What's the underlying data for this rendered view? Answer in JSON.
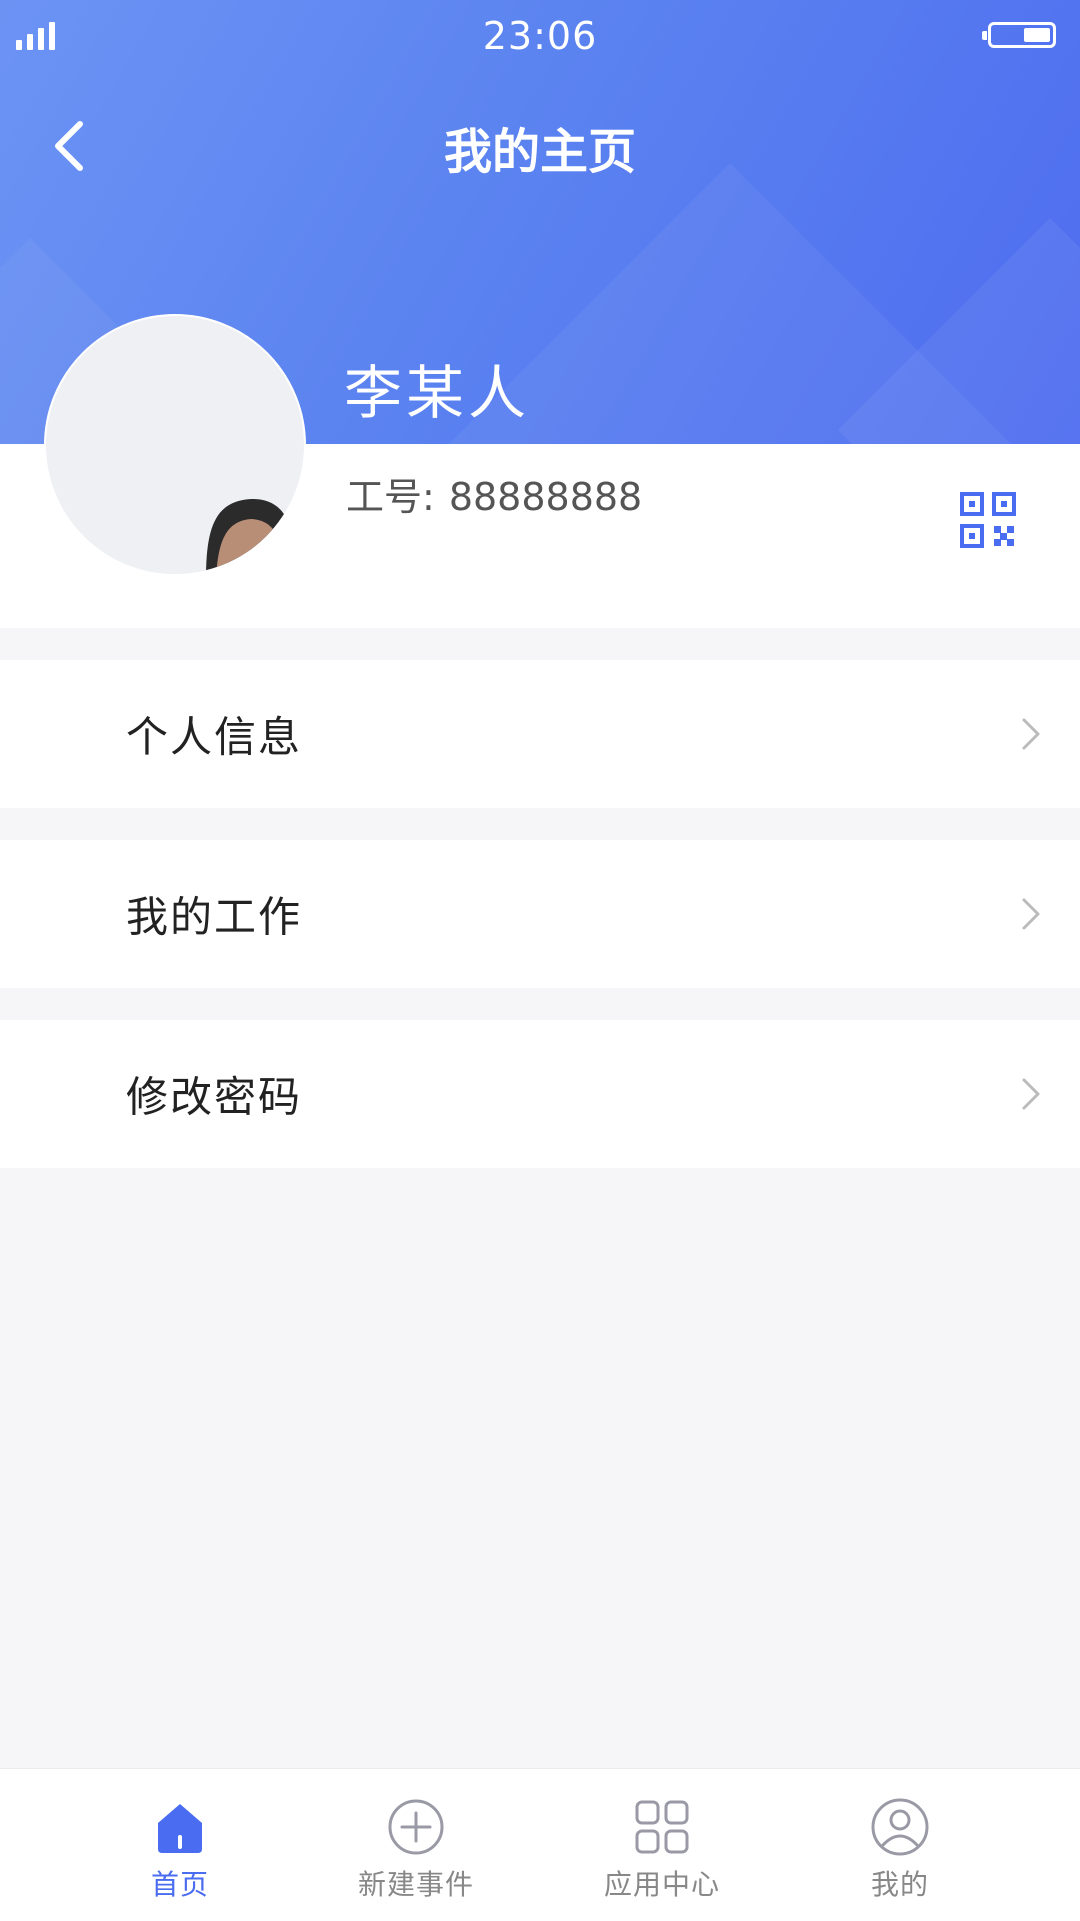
{
  "status_bar": {
    "time": "23:06"
  },
  "header": {
    "title": "我的主页"
  },
  "profile": {
    "name": "李某人",
    "employee_id_label": "工号:",
    "employee_id": "88888888"
  },
  "menu": {
    "items": [
      {
        "label": "个人信息"
      },
      {
        "label": "我的工作"
      },
      {
        "label": "修改密码"
      }
    ]
  },
  "tabbar": {
    "tabs": [
      {
        "label": "首页",
        "icon": "home-icon",
        "active": true
      },
      {
        "label": "新建事件",
        "icon": "plus-circle-icon",
        "active": false
      },
      {
        "label": "应用中心",
        "icon": "grid-icon",
        "active": false
      },
      {
        "label": "我的",
        "icon": "user-icon",
        "active": false
      }
    ]
  },
  "colors": {
    "accent": "#4a6cf0",
    "header_gradient_start": "#6c93f4",
    "header_gradient_end": "#4e6cf0",
    "background": "#f6f6f9"
  }
}
